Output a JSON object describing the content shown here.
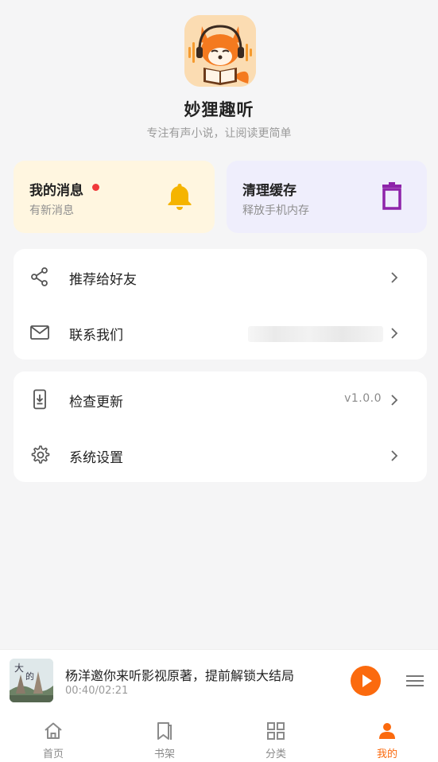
{
  "app": {
    "name": "妙狸趣听",
    "slogan": "专注有声小说，让阅读更简单"
  },
  "cards": {
    "messages": {
      "title": "我的消息",
      "subtitle": "有新消息",
      "has_unread": true,
      "icon": "bell-icon",
      "color": "#f5b400"
    },
    "cache": {
      "title": "清理缓存",
      "subtitle": "释放手机内存",
      "icon": "trash-icon",
      "color": "#8e24aa"
    }
  },
  "menu_group_1": [
    {
      "label": "推荐给好友",
      "icon": "share-icon"
    },
    {
      "label": "联系我们",
      "icon": "mail-icon"
    }
  ],
  "menu_group_2": [
    {
      "label": "检查更新",
      "icon": "download-phone-icon",
      "value": "v1.0.0"
    },
    {
      "label": "系统设置",
      "icon": "gear-icon"
    }
  ],
  "player": {
    "title": "杨洋邀你来听影视原著，提前解锁大结局",
    "time": "00:40/02:21",
    "accent": "#fb6a0e"
  },
  "tabs": [
    {
      "label": "首页",
      "icon": "home-icon"
    },
    {
      "label": "书架",
      "icon": "bookmark-icon"
    },
    {
      "label": "分类",
      "icon": "grid-icon"
    },
    {
      "label": "我的",
      "icon": "person-icon",
      "active": true
    }
  ]
}
